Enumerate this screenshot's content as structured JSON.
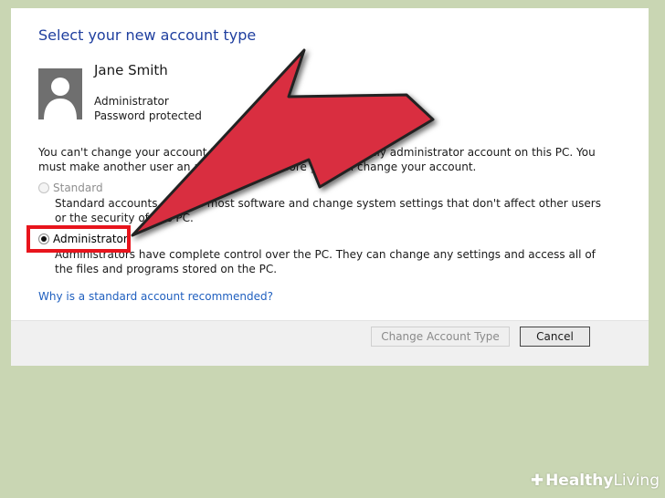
{
  "dialog": {
    "title": "Select your new account type",
    "user": {
      "name": "Jane Smith",
      "role": "Administrator",
      "password_status": "Password protected"
    },
    "notice": "You can't change your account type because you have the only administrator account on this PC. You must make another user an administrator before you can change your account.",
    "options": [
      {
        "label": "Standard",
        "description": "Standard accounts can use most software and change system settings that don't affect other users or the security of this PC.",
        "selected": false,
        "enabled": false
      },
      {
        "label": "Administrator",
        "description": "Administrators have complete control over the PC. They can change any settings and access all of the files and programs stored on the PC.",
        "selected": true,
        "enabled": true
      }
    ],
    "help_link": "Why is a standard account recommended?",
    "buttons": {
      "change": "Change Account Type",
      "cancel": "Cancel"
    }
  },
  "overlay": {
    "arrow_color": "#d92f3f",
    "highlight_color": "#e8141c"
  },
  "watermark": {
    "brand_word1": "Healthy",
    "brand_word2": "Living"
  },
  "colors": {
    "background": "#c9d6b3",
    "title_blue": "#1f3f9f",
    "link_blue": "#1f5fbf"
  }
}
